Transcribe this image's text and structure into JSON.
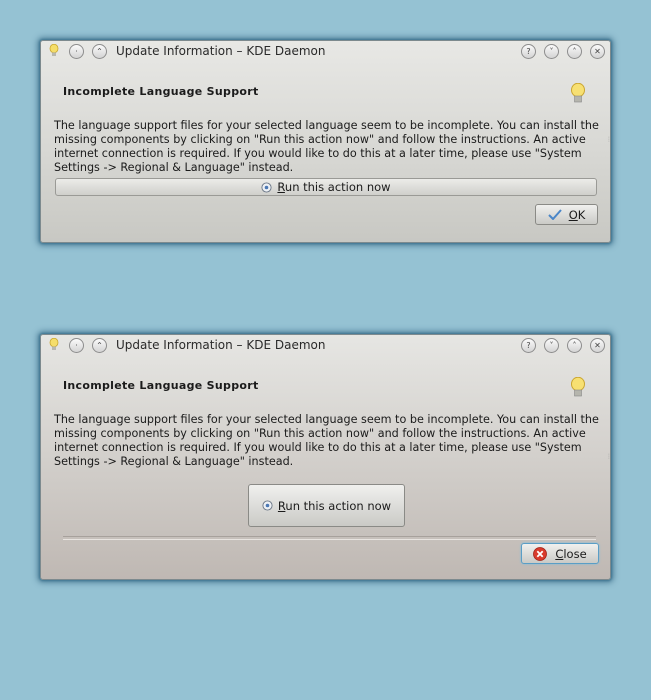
{
  "dialog1": {
    "title": "Update Information – KDE Daemon",
    "heading": "Incomplete Language Support",
    "message": "The language support files for your selected language seem to be incomplete. You can install the missing components by clicking on \"Run this action now\" and follow the instructions. An active internet connection is required. If you would like to do this at a later time, please use \"System Settings -> Regional & Language\" instead.",
    "run_label_first": "R",
    "run_label_rest": "un this action now",
    "ok_first": "O",
    "ok_rest": "K"
  },
  "dialog2": {
    "title": "Update Information – KDE Daemon",
    "heading": "Incomplete Language Support",
    "message": "The language support files for your selected language seem to be incomplete. You can install the missing components by clicking on \"Run this action now\" and follow the instructions. An active internet connection is required. If you would like to do this at a later time, please use \"System Settings -> Regional & Language\" instead.",
    "run_label_first": "R",
    "run_label_rest": "un this action now",
    "close_first": "C",
    "close_rest": "lose"
  },
  "titlebar_buttons": {
    "help": "?",
    "minimize": "˅",
    "maximize": "˄",
    "close": "✕",
    "menu": "·",
    "keep_above": "⌃"
  },
  "colors": {
    "desktop": "#95c2d3",
    "close_icon": "#d93a2b",
    "ok_check": "#4a86c8"
  }
}
